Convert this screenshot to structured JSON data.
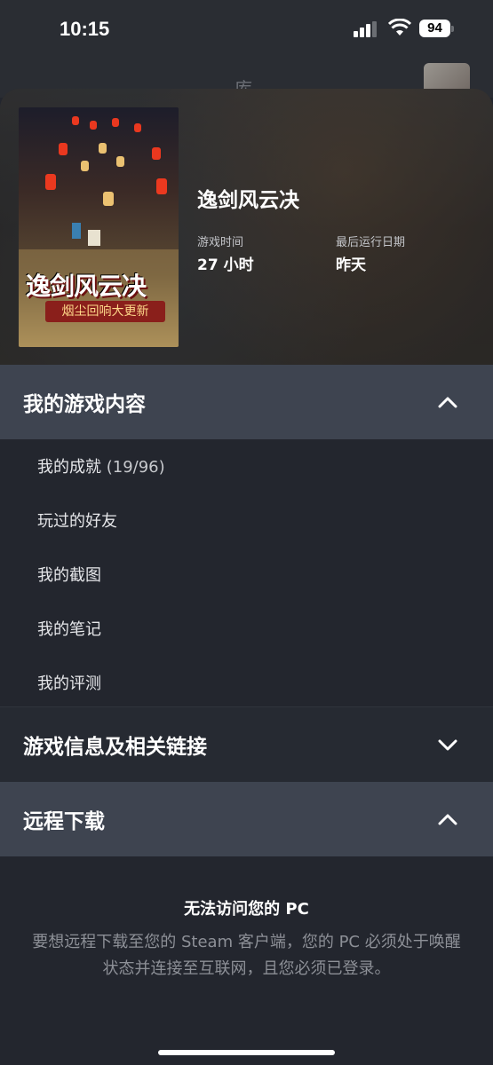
{
  "status_bar": {
    "time": "10:15",
    "battery": "94"
  },
  "background": {
    "title": "库"
  },
  "game": {
    "title": "逸剑风云决",
    "cover_title": "逸剑风云决",
    "cover_banner": "烟尘回响大更新",
    "playtime_label": "游戏时间",
    "playtime_value": "27 小时",
    "last_run_label": "最后运行日期",
    "last_run_value": "昨天"
  },
  "sections": {
    "my_content": {
      "title": "我的游戏内容",
      "state": "expanded",
      "items": [
        {
          "label": "我的成就",
          "count": "(19/96)"
        },
        {
          "label": "玩过的好友"
        },
        {
          "label": "我的截图"
        },
        {
          "label": "我的笔记"
        },
        {
          "label": "我的评测"
        }
      ]
    },
    "game_info": {
      "title": "游戏信息及相关链接",
      "state": "collapsed"
    },
    "remote_download": {
      "title": "远程下载",
      "state": "expanded",
      "message_title": "无法访问您的 PC",
      "message_body": "要想远程下载至您的 Steam 客户端，您的 PC 必须处于唤醒状态并连接至互联网，且您必须已登录。"
    }
  },
  "colors": {
    "background": "#23262e",
    "expanded_header": "#3e4450",
    "muted_text": "#8d9097"
  }
}
